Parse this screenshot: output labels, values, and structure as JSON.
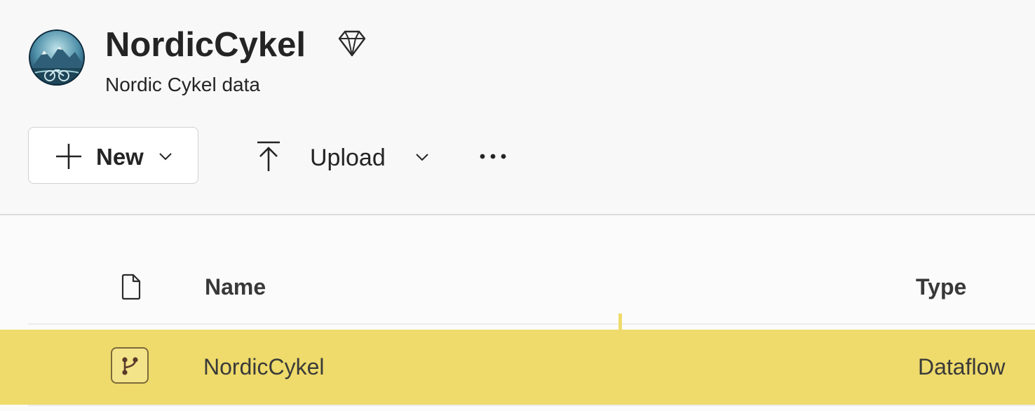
{
  "workspace": {
    "title": "NordicCykel",
    "description": "Nordic Cykel data",
    "avatar_icon": "workspace-avatar-icon",
    "premium_icon": "diamond-icon"
  },
  "toolbar": {
    "new_label": "New",
    "upload_label": "Upload",
    "more_icon": "more-icon"
  },
  "table": {
    "columns": {
      "icon_header": "file-icon",
      "name": "Name",
      "type": "Type"
    },
    "rows": [
      {
        "icon": "dataflow-icon",
        "name": "NordicCykel",
        "type": "Dataflow",
        "highlighted": true
      }
    ]
  },
  "colors": {
    "highlight": "#efdb6b",
    "text": "#242424",
    "background": "#f8f8f8"
  }
}
